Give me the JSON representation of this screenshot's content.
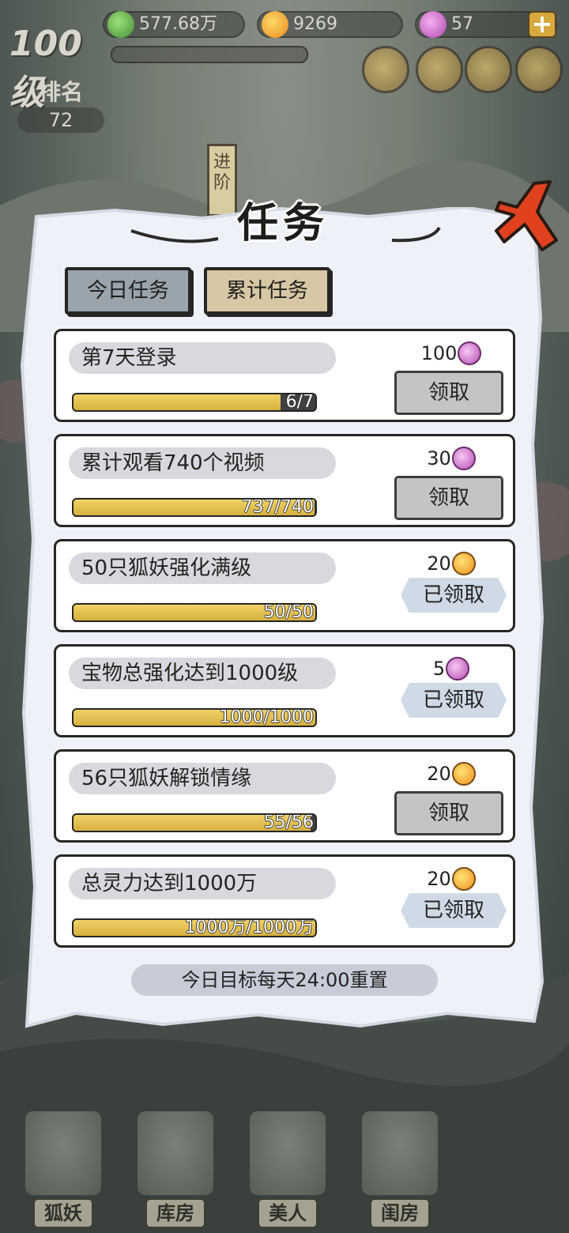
{
  "hud": {
    "resources": [
      {
        "id": "jade",
        "value": "577.68万",
        "icon": "jade-icon",
        "color": "#5fb04a"
      },
      {
        "id": "coin",
        "value": "9269",
        "icon": "coin-icon",
        "color": "#f0a531"
      },
      {
        "id": "gem",
        "value": "57",
        "icon": "gem-icon",
        "color": "#c55ac2"
      }
    ],
    "plus_label": "+",
    "level": "100级",
    "rank_label": "排名",
    "rank_value": "72",
    "advance_label": "进阶"
  },
  "dialog": {
    "title": "任务",
    "tabs": [
      {
        "label": "今日任务",
        "active": false
      },
      {
        "label": "累计任务",
        "active": true
      }
    ],
    "tasks": [
      {
        "title": "第7天登录",
        "progress_text": "6/7",
        "progress": 0.857,
        "reward_amount": "100",
        "reward_icon": "gem-icon",
        "status": "claimable",
        "action_label": "领取"
      },
      {
        "title": "累计观看740个视频",
        "progress_text": "737/740",
        "progress": 0.996,
        "reward_amount": "30",
        "reward_icon": "gem-icon",
        "status": "claimable",
        "action_label": "领取"
      },
      {
        "title": "50只狐妖强化满级",
        "progress_text": "50/50",
        "progress": 1.0,
        "reward_amount": "20",
        "reward_icon": "coin-icon",
        "status": "claimed",
        "action_label": "已领取"
      },
      {
        "title": "宝物总强化达到1000级",
        "progress_text": "1000/1000",
        "progress": 1.0,
        "reward_amount": "5",
        "reward_icon": "gem-icon",
        "status": "claimed",
        "action_label": "已领取"
      },
      {
        "title": "56只狐妖解锁情缘",
        "progress_text": "55/56",
        "progress": 0.982,
        "reward_amount": "20",
        "reward_icon": "coin-icon",
        "status": "claimable",
        "action_label": "领取"
      },
      {
        "title": "总灵力达到1000万",
        "progress_text": "1000万/1000万",
        "progress": 1.0,
        "reward_amount": "20",
        "reward_icon": "coin-icon",
        "status": "claimed",
        "action_label": "已领取"
      }
    ],
    "reset_note": "今日目标每天24:00重置"
  },
  "bottom_nav": [
    {
      "label": "狐妖"
    },
    {
      "label": "库房"
    },
    {
      "label": "美人"
    },
    {
      "label": "闺房"
    }
  ]
}
